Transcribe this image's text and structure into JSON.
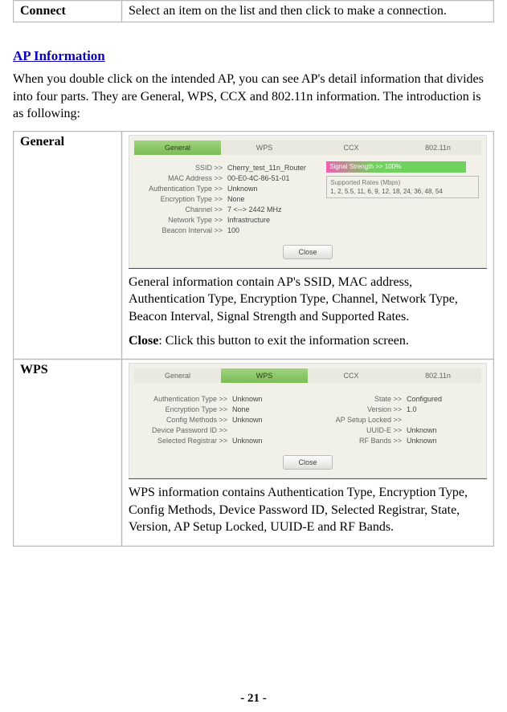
{
  "connect_row": {
    "label": "Connect",
    "desc": "Select an item on the list and then click to make a connection."
  },
  "section_title": "AP Information",
  "intro_para": "When you double click on the intended AP, you can see AP's detail information that divides into four parts. They are General, WPS, CCX and 802.11n information. The introduction is as following:",
  "tabs": {
    "general": "General",
    "wps": "WPS",
    "ccx": "CCX",
    "n": "802.11n"
  },
  "general_row": {
    "label": "General",
    "shot": {
      "kv": {
        "ssid_k": "SSID >>",
        "ssid_v": "Cherry_test_11n_Router",
        "mac_k": "MAC Address >>",
        "mac_v": "00-E0-4C-86-51-01",
        "auth_k": "Authentication Type >>",
        "auth_v": "Unknown",
        "enc_k": "Encryption Type >>",
        "enc_v": "None",
        "ch_k": "Channel >>",
        "ch_v": "7 <--> 2442 MHz",
        "nt_k": "Network Type >>",
        "nt_v": "Infrastructure",
        "bi_k": "Beacon Interval >>",
        "bi_v": "100"
      },
      "sig_label": "Signal Strength >> 100%",
      "rates_title": "Supported Rates (Mbps)",
      "rates_vals": "1, 2, 5.5, 11, 6, 9, 12, 18, 24, 36, 48, 54",
      "close": "Close"
    },
    "desc1": "General information contain AP's SSID, MAC address, Authentication Type, Encryption Type, Channel, Network Type, Beacon Interval, Signal Strength and Supported Rates.",
    "close_label": "Close",
    "close_desc": ": Click this button to exit the information screen."
  },
  "wps_row": {
    "label": "WPS",
    "shot": {
      "left": {
        "auth_k": "Authentication Type >>",
        "auth_v": "Unknown",
        "enc_k": "Encryption Type >>",
        "enc_v": "None",
        "cfg_k": "Config Methods >>",
        "cfg_v": "Unknown",
        "dpi_k": "Device Password ID >>",
        "dpi_v": "",
        "sreg_k": "Selected Registrar >>",
        "sreg_v": "Unknown"
      },
      "right": {
        "state_k": "State >>",
        "state_v": "Configured",
        "ver_k": "Version >>",
        "ver_v": "1.0",
        "apsl_k": "AP Setup Locked >>",
        "apsl_v": "",
        "uuid_k": "UUID-E >>",
        "uuid_v": "Unknown",
        "rfb_k": "RF Bands >>",
        "rfb_v": "Unknown"
      },
      "close": "Close"
    },
    "desc": "WPS information contains Authentication Type, Encryption Type, Config Methods, Device Password ID, Selected Registrar, State, Version, AP Setup Locked, UUID-E and RF Bands."
  },
  "page_number": "- 21 -"
}
